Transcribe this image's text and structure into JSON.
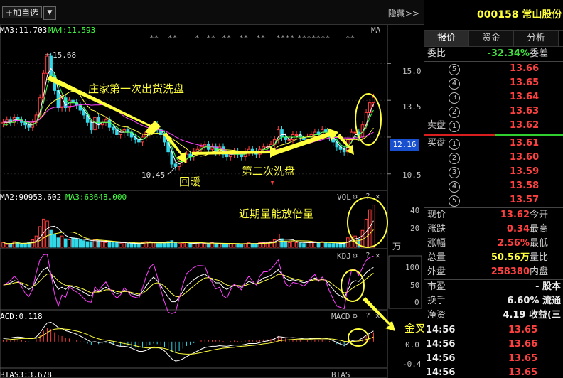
{
  "topbar": {
    "add_watch_label": "+加自选",
    "dropdown_glyph": "▼",
    "hide_label": "隐藏>>"
  },
  "legends": {
    "ma3": "MA3:11.703",
    "ma4": "MA4:11.593",
    "ma_tag": "MA",
    "vol_ma2": "MA2:90953.602",
    "vol_ma3": "MA3:63648.000",
    "vol_tag": "VOL",
    "kdj_tag": "KDJ",
    "macd_val": "ACD:0.118",
    "macd_tag": "MACD",
    "bias_val": "BIAS3:3.678",
    "bias_tag": "BIAS"
  },
  "stars": [
    "**",
    "**",
    "*",
    "**",
    "**",
    "**",
    "**",
    "****",
    "*******",
    "**"
  ],
  "price_tags": {
    "high": "15.68",
    "low": "10.45",
    "current": "12.16"
  },
  "axis": {
    "price": [
      "15.0",
      "13.5",
      "12.0",
      "10.5"
    ],
    "vol": [
      "40",
      "20"
    ],
    "vol_unit": "万",
    "kdj": [
      "100",
      "50",
      "0"
    ],
    "macd": [
      "0.0",
      "-0.4"
    ]
  },
  "annotations": {
    "first_wash": "庄家第一次出货洗盘",
    "rebound": "回暖",
    "second_wash": "第二次洗盘",
    "volume_up": "近期量能放倍量",
    "golden_cross": "金叉"
  },
  "chart_data": {
    "type": "candlestick",
    "title": "",
    "ylim": [
      10.0,
      16.2
    ],
    "x": [
      1,
      2,
      3,
      4,
      5,
      6,
      7,
      8,
      9,
      10,
      11,
      12,
      13,
      14,
      15,
      16,
      17,
      18,
      19,
      20,
      21,
      22,
      23,
      24,
      25,
      26,
      27,
      28,
      29,
      30,
      31,
      32,
      33,
      34,
      35,
      36,
      37,
      38,
      39,
      40,
      41,
      42,
      43,
      44,
      45,
      46,
      47,
      48,
      49,
      50,
      51,
      52,
      53,
      54,
      55,
      56,
      57,
      58,
      59,
      60,
      61,
      62,
      63,
      64,
      65,
      66,
      67,
      68,
      69,
      70,
      71,
      72,
      73,
      74,
      75,
      76,
      77,
      78,
      79,
      80,
      81,
      82,
      83,
      84,
      85,
      86,
      87,
      88,
      89,
      90,
      91,
      92,
      93,
      94,
      95,
      96,
      97,
      98,
      99,
      100,
      101,
      102
    ],
    "close": [
      12.6,
      12.7,
      12.6,
      12.8,
      12.7,
      12.6,
      12.5,
      12.4,
      12.6,
      12.9,
      13.6,
      14.6,
      15.3,
      14.5,
      13.9,
      13.2,
      13.6,
      13.2,
      13.5,
      13.4,
      13.3,
      13.1,
      12.9,
      12.6,
      12.3,
      12.8,
      12.5,
      12.6,
      12.7,
      12.4,
      12.3,
      12.1,
      12.2,
      12.3,
      12.2,
      12.0,
      11.9,
      11.8,
      12.0,
      12.2,
      12.4,
      12.5,
      12.3,
      12.1,
      11.8,
      11.4,
      10.9,
      10.8,
      11.0,
      11.1,
      11.3,
      11.2,
      11.4,
      11.5,
      11.6,
      11.7,
      11.5,
      11.6,
      11.4,
      11.6,
      11.3,
      11.2,
      11.3,
      11.4,
      11.3,
      11.2,
      11.4,
      11.5,
      11.4,
      11.3,
      11.5,
      11.6,
      11.6,
      11.7,
      11.9,
      12.3,
      12.0,
      11.9,
      11.9,
      12.1,
      12.1,
      12.0,
      11.9,
      12.0,
      12.1,
      12.2,
      12.1,
      12.3,
      12.2,
      12.0,
      11.8,
      11.6,
      11.5,
      11.4,
      11.9,
      12.2,
      12.2,
      12.0,
      12.5,
      13.0,
      13.4,
      13.62
    ],
    "series": [
      {
        "name": "MA3",
        "values": [
          12.6,
          12.6,
          12.6,
          12.7,
          12.7,
          12.7,
          12.6,
          12.5,
          12.5,
          12.6,
          13.0,
          13.7,
          14.5,
          14.8,
          14.6,
          13.9,
          13.6,
          13.3,
          13.4,
          13.4,
          13.4,
          13.3,
          13.1,
          12.9,
          12.6,
          12.6,
          12.5,
          12.6,
          12.6,
          12.6,
          12.5,
          12.3,
          12.2,
          12.2,
          12.2,
          12.2,
          12.0,
          11.9,
          11.9,
          12.0,
          12.2,
          12.4,
          12.4,
          12.3,
          12.1,
          11.8,
          11.4,
          11.0,
          10.9,
          11.0,
          11.1,
          11.2,
          11.3,
          11.4,
          11.5,
          11.6,
          11.6,
          11.6,
          11.5,
          11.5,
          11.4,
          11.4,
          11.3,
          11.3,
          11.3,
          11.3,
          11.3,
          11.4,
          11.4,
          11.4,
          11.4,
          11.5,
          11.6,
          11.6,
          11.7,
          12.0,
          12.1,
          12.1,
          11.9,
          12.0,
          12.0,
          12.1,
          12.0,
          12.0,
          12.0,
          12.1,
          12.1,
          12.2,
          12.2,
          12.2,
          12.0,
          11.8,
          11.6,
          11.5,
          11.6,
          11.8,
          12.1,
          12.1,
          12.2,
          12.5,
          13.0,
          13.34
        ]
      },
      {
        "name": "MA4",
        "values": [
          12.5,
          12.5,
          12.6,
          12.6,
          12.7,
          12.7,
          12.6,
          12.6,
          12.5,
          12.6,
          12.9,
          13.4,
          14.1,
          14.5,
          14.6,
          14.2,
          13.8,
          13.5,
          13.4,
          13.4,
          13.4,
          13.3,
          13.2,
          13.0,
          12.7,
          12.6,
          12.6,
          12.6,
          12.6,
          12.6,
          12.5,
          12.4,
          12.3,
          12.2,
          12.2,
          12.2,
          12.1,
          12.0,
          11.9,
          12.0,
          12.1,
          12.3,
          12.3,
          12.3,
          12.2,
          11.9,
          11.6,
          11.2,
          11.0,
          11.0,
          11.1,
          11.2,
          11.2,
          11.4,
          11.5,
          11.6,
          11.6,
          11.6,
          11.5,
          11.5,
          11.5,
          11.4,
          11.4,
          11.3,
          11.3,
          11.3,
          11.3,
          11.4,
          11.4,
          11.4,
          11.4,
          11.5,
          11.5,
          11.6,
          11.7,
          11.9,
          12.0,
          12.0,
          12.0,
          12.0,
          12.0,
          12.0,
          12.0,
          12.0,
          12.0,
          12.1,
          12.1,
          12.2,
          12.2,
          12.2,
          12.1,
          11.9,
          11.7,
          11.6,
          11.6,
          11.8,
          12.0,
          12.1,
          12.2,
          12.4,
          12.8,
          13.1
        ]
      }
    ],
    "volume_ylim": [
      0,
      50
    ],
    "volume": [
      5,
      3,
      4,
      6,
      5,
      3,
      4,
      5,
      8,
      12,
      22,
      30,
      28,
      18,
      14,
      10,
      12,
      9,
      8,
      10,
      9,
      8,
      7,
      6,
      6,
      8,
      7,
      6,
      5,
      6,
      5,
      5,
      4,
      5,
      4,
      4,
      4,
      4,
      5,
      6,
      6,
      5,
      4,
      4,
      5,
      6,
      7,
      5,
      4,
      4,
      5,
      4,
      4,
      5,
      5,
      4,
      4,
      5,
      4,
      4,
      4,
      3,
      4,
      4,
      4,
      3,
      4,
      5,
      4,
      4,
      5,
      5,
      5,
      6,
      8,
      14,
      9,
      6,
      5,
      6,
      5,
      5,
      4,
      5,
      5,
      6,
      5,
      6,
      5,
      4,
      4,
      4,
      4,
      5,
      10,
      14,
      12,
      8,
      18,
      30,
      40,
      45
    ],
    "kdj_ylim": [
      0,
      110
    ],
    "kdj_k": [
      50,
      52,
      55,
      60,
      58,
      52,
      45,
      40,
      45,
      60,
      75,
      85,
      90,
      75,
      55,
      40,
      45,
      40,
      48,
      45,
      42,
      38,
      33,
      28,
      25,
      38,
      35,
      40,
      45,
      40,
      35,
      30,
      32,
      38,
      35,
      30,
      28,
      26,
      35,
      48,
      60,
      68,
      60,
      48,
      35,
      22,
      12,
      12,
      22,
      35,
      48,
      55,
      62,
      68,
      72,
      75,
      68,
      62,
      55,
      55,
      45,
      40,
      45,
      50,
      48,
      45,
      52,
      58,
      55,
      52,
      60,
      66,
      68,
      72,
      78,
      85,
      75,
      65,
      60,
      62,
      60,
      58,
      55,
      58,
      62,
      66,
      60,
      64,
      60,
      50,
      40,
      30,
      25,
      20,
      38,
      55,
      60,
      58,
      68,
      78,
      85,
      90
    ],
    "kdj_d": [
      50,
      51,
      52,
      55,
      56,
      55,
      52,
      48,
      47,
      51,
      59,
      68,
      75,
      75,
      68,
      59,
      54,
      49,
      49,
      48,
      46,
      43,
      40,
      36,
      32,
      34,
      34,
      36,
      39,
      39,
      38,
      35,
      34,
      35,
      35,
      33,
      31,
      29,
      31,
      37,
      45,
      53,
      55,
      53,
      47,
      39,
      30,
      24,
      23,
      27,
      34,
      41,
      48,
      55,
      61,
      66,
      67,
      65,
      62,
      60,
      55,
      50,
      48,
      49,
      49,
      48,
      49,
      52,
      53,
      53,
      55,
      59,
      62,
      65,
      69,
      74,
      74,
      71,
      67,
      65,
      63,
      61,
      59,
      59,
      60,
      62,
      61,
      62,
      61,
      57,
      51,
      44,
      38,
      32,
      34,
      41,
      47,
      51,
      57,
      64,
      71,
      77
    ],
    "kdj_j": [
      50,
      54,
      61,
      70,
      62,
      46,
      31,
      24,
      41,
      78,
      107,
      119,
      120,
      75,
      29,
      2,
      27,
      22,
      46,
      39,
      34,
      28,
      19,
      12,
      11,
      46,
      37,
      48,
      57,
      42,
      29,
      20,
      28,
      44,
      35,
      24,
      22,
      20,
      43,
      70,
      90,
      98,
      70,
      38,
      11,
      -12,
      -24,
      -12,
      20,
      51,
      76,
      83,
      90,
      94,
      94,
      93,
      70,
      56,
      41,
      45,
      25,
      20,
      39,
      52,
      46,
      39,
      58,
      70,
      59,
      50,
      70,
      80,
      80,
      86,
      96,
      107,
      77,
      53,
      46,
      56,
      54,
      52,
      47,
      56,
      66,
      74,
      58,
      68,
      58,
      36,
      18,
      2,
      -1,
      -4,
      46,
      83,
      86,
      72,
      90,
      106,
      113,
      116
    ],
    "macd_ylim": [
      -0.8,
      0.7
    ],
    "macd_hist": [
      0.05,
      0.06,
      0.06,
      0.08,
      0.07,
      0.05,
      0.02,
      -0.01,
      0.0,
      0.08,
      0.2,
      0.35,
      0.45,
      0.4,
      0.3,
      0.2,
      0.18,
      0.12,
      0.1,
      0.08,
      0.05,
      0.02,
      -0.02,
      -0.06,
      -0.1,
      -0.06,
      -0.08,
      -0.06,
      -0.04,
      -0.06,
      -0.09,
      -0.13,
      -0.14,
      -0.12,
      -0.13,
      -0.16,
      -0.19,
      -0.22,
      -0.2,
      -0.15,
      -0.1,
      -0.06,
      -0.08,
      -0.12,
      -0.18,
      -0.26,
      -0.34,
      -0.36,
      -0.3,
      -0.22,
      -0.14,
      -0.1,
      -0.05,
      0.0,
      0.04,
      0.07,
      0.06,
      0.06,
      0.04,
      0.05,
      0.02,
      0.0,
      0.02,
      0.03,
      0.02,
      0.01,
      0.03,
      0.05,
      0.04,
      0.03,
      0.05,
      0.07,
      0.08,
      0.09,
      0.12,
      0.18,
      0.14,
      0.1,
      0.08,
      0.09,
      0.08,
      0.07,
      0.05,
      0.05,
      0.06,
      0.07,
      0.05,
      0.07,
      0.05,
      0.02,
      -0.03,
      -0.08,
      -0.12,
      -0.15,
      -0.06,
      0.02,
      0.05,
      0.04,
      0.1,
      0.18,
      0.25,
      0.3
    ],
    "macd_dif": [
      0.1,
      0.11,
      0.12,
      0.14,
      0.15,
      0.14,
      0.12,
      0.1,
      0.1,
      0.15,
      0.28,
      0.45,
      0.6,
      0.62,
      0.55,
      0.45,
      0.42,
      0.35,
      0.32,
      0.28,
      0.24,
      0.18,
      0.12,
      0.05,
      -0.02,
      0.0,
      -0.03,
      -0.02,
      0.0,
      -0.03,
      -0.08,
      -0.13,
      -0.15,
      -0.15,
      -0.17,
      -0.21,
      -0.26,
      -0.31,
      -0.31,
      -0.28,
      -0.22,
      -0.17,
      -0.18,
      -0.22,
      -0.3,
      -0.42,
      -0.55,
      -0.62,
      -0.6,
      -0.55,
      -0.48,
      -0.42,
      -0.36,
      -0.3,
      -0.24,
      -0.19,
      -0.17,
      -0.15,
      -0.15,
      -0.13,
      -0.14,
      -0.15,
      -0.13,
      -0.11,
      -0.11,
      -0.11,
      -0.09,
      -0.06,
      -0.06,
      -0.06,
      -0.03,
      0.0,
      0.02,
      0.05,
      0.09,
      0.16,
      0.15,
      0.13,
      0.12,
      0.13,
      0.12,
      0.11,
      0.09,
      0.09,
      0.1,
      0.11,
      0.1,
      0.12,
      0.11,
      0.08,
      0.03,
      -0.03,
      -0.08,
      -0.12,
      -0.06,
      0.02,
      0.05,
      0.05,
      0.12,
      0.2,
      0.27,
      0.34
    ],
    "macd_dea": [
      0.05,
      0.06,
      0.07,
      0.08,
      0.09,
      0.1,
      0.1,
      0.1,
      0.1,
      0.11,
      0.15,
      0.21,
      0.29,
      0.36,
      0.4,
      0.41,
      0.41,
      0.4,
      0.39,
      0.36,
      0.34,
      0.31,
      0.27,
      0.23,
      0.17,
      0.13,
      0.09,
      0.06,
      0.05,
      0.03,
      0.01,
      -0.01,
      -0.04,
      -0.06,
      -0.08,
      -0.1,
      -0.13,
      -0.16,
      -0.18,
      -0.2,
      -0.2,
      -0.2,
      -0.2,
      -0.2,
      -0.22,
      -0.25,
      -0.3,
      -0.35,
      -0.38,
      -0.39,
      -0.4,
      -0.4,
      -0.39,
      -0.37,
      -0.35,
      -0.32,
      -0.3,
      -0.27,
      -0.25,
      -0.23,
      -0.21,
      -0.2,
      -0.19,
      -0.18,
      -0.16,
      -0.15,
      -0.14,
      -0.13,
      -0.12,
      -0.11,
      -0.09,
      -0.07,
      -0.06,
      -0.04,
      -0.02,
      0.02,
      0.04,
      0.05,
      0.06,
      0.07,
      0.08,
      0.08,
      0.08,
      0.08,
      0.08,
      0.09,
      0.09,
      0.09,
      0.09,
      0.09,
      0.08,
      0.06,
      0.04,
      0.01,
      0.0,
      0.0,
      0.01,
      0.02,
      0.04,
      0.07,
      0.1,
      0.15
    ]
  },
  "quote": {
    "code_name": "000158 常山股份",
    "tabs": [
      "报价",
      "资金",
      "分析"
    ],
    "weibi_label": "委比",
    "weibi_value": "-32.34%",
    "weicha_label": "委差",
    "sell_label": "卖盘",
    "buy_label": "买盘",
    "sell_levels": [
      {
        "lvl": "5",
        "price": "13.66"
      },
      {
        "lvl": "4",
        "price": "13.65"
      },
      {
        "lvl": "3",
        "price": "13.64"
      },
      {
        "lvl": "2",
        "price": "13.63"
      },
      {
        "lvl": "1",
        "price": "13.62"
      }
    ],
    "buy_levels": [
      {
        "lvl": "1",
        "price": "13.61"
      },
      {
        "lvl": "2",
        "price": "13.60"
      },
      {
        "lvl": "3",
        "price": "13.59"
      },
      {
        "lvl": "4",
        "price": "13.58"
      },
      {
        "lvl": "5",
        "price": "13.57"
      }
    ],
    "stats": [
      {
        "label": "现价",
        "value": "13.62",
        "cls": "red",
        "label2": "今开"
      },
      {
        "label": "涨跌",
        "value": "0.34",
        "cls": "red",
        "label2": "最高"
      },
      {
        "label": "涨幅",
        "value": "2.56%",
        "cls": "red",
        "label2": "最低"
      },
      {
        "label": "总量",
        "value": "50.56万",
        "cls": "yellow",
        "label2": "量比"
      },
      {
        "label": "外盘",
        "value": "258380",
        "cls": "red",
        "label2": "内盘"
      }
    ],
    "stats2": [
      {
        "label": "市盈",
        "value": "- 股本",
        "cls": "white",
        "label2": ""
      },
      {
        "label": "换手",
        "value": "6.60% 流通",
        "cls": "white",
        "label2": ""
      },
      {
        "label": "净资",
        "value": "4.19 收益(三",
        "cls": "white",
        "label2": ""
      }
    ],
    "ticks": [
      {
        "time": "14:56",
        "price": "13.65"
      },
      {
        "time": "14:56",
        "price": "13.66"
      },
      {
        "time": "14:56",
        "price": "13.65"
      },
      {
        "time": "14:56",
        "price": "13.65"
      }
    ],
    "colors": {
      "up": "#ff4040",
      "down": "#3fdf3f",
      "accent": "#ffff3c"
    }
  }
}
